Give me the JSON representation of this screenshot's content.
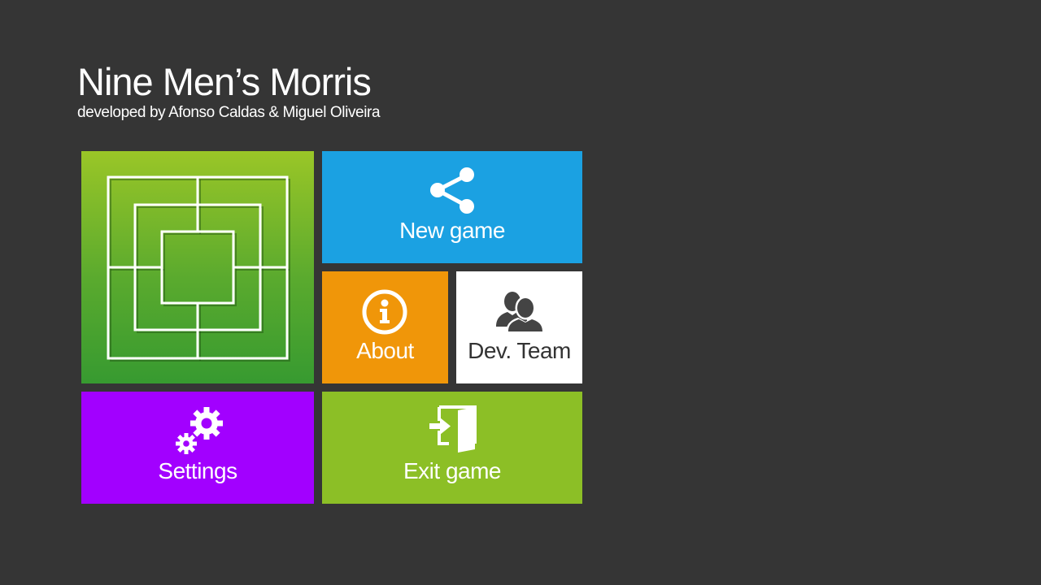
{
  "app": {
    "title": "Nine Men’s Morris",
    "subtitle": "developed by Afonso Caldas & Miguel Oliveira"
  },
  "tiles": {
    "board": {
      "icon": "morris-board-icon",
      "color": "#5aaa2e"
    },
    "new_game": {
      "label": "New game",
      "icon": "share-icon",
      "color": "#1ba1e2"
    },
    "about": {
      "label": "About",
      "icon": "info-icon",
      "color": "#f09609"
    },
    "dev_team": {
      "label": "Dev. Team",
      "icon": "users-icon",
      "color": "#ffffff"
    },
    "settings": {
      "label": "Settings",
      "icon": "gears-icon",
      "color": "#a200ff"
    },
    "exit_game": {
      "label": "Exit game",
      "icon": "exit-door-icon",
      "color": "#8cbf26"
    }
  }
}
